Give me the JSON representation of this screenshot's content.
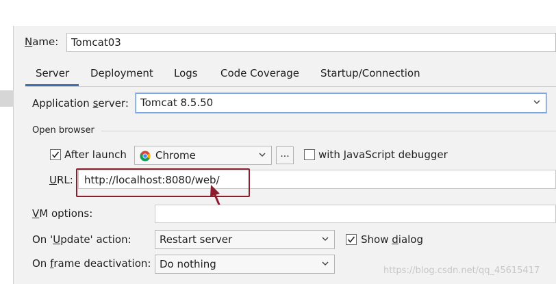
{
  "name": {
    "label": "Name:",
    "value": "Tomcat03"
  },
  "tabs": [
    {
      "label": "Server",
      "selected": true
    },
    {
      "label": "Deployment"
    },
    {
      "label": "Logs"
    },
    {
      "label": "Code Coverage"
    },
    {
      "label": "Startup/Connection"
    }
  ],
  "app_server": {
    "label": "Application server:",
    "value": "Tomcat 8.5.50"
  },
  "open_browser": {
    "section_title": "Open browser",
    "after_launch_label": "After launch",
    "after_launch_checked": true,
    "browser": {
      "value": "Chrome",
      "icon": "chrome-icon"
    },
    "browse_button": "...",
    "js_debugger_label": "with JavaScript debugger",
    "js_debugger_checked": false,
    "url_label": "URL:",
    "url_value": "http://localhost:8080/web/"
  },
  "vm_options": {
    "label": "VM options:",
    "value": ""
  },
  "on_update": {
    "label": "On 'Update' action:",
    "value": "Restart server"
  },
  "show_dialog": {
    "label": "Show dialog",
    "checked": true
  },
  "on_frame_deactivation": {
    "label": "On frame deactivation:",
    "value": "Do nothing"
  },
  "annotation": {
    "color": "#8b1e2c"
  },
  "colors": {
    "accent": "#3d6fb0",
    "focus": "#6f9ad7",
    "annotation": "#8b1e2c"
  },
  "watermark": "https://blog.csdn.net/qq_45615417"
}
